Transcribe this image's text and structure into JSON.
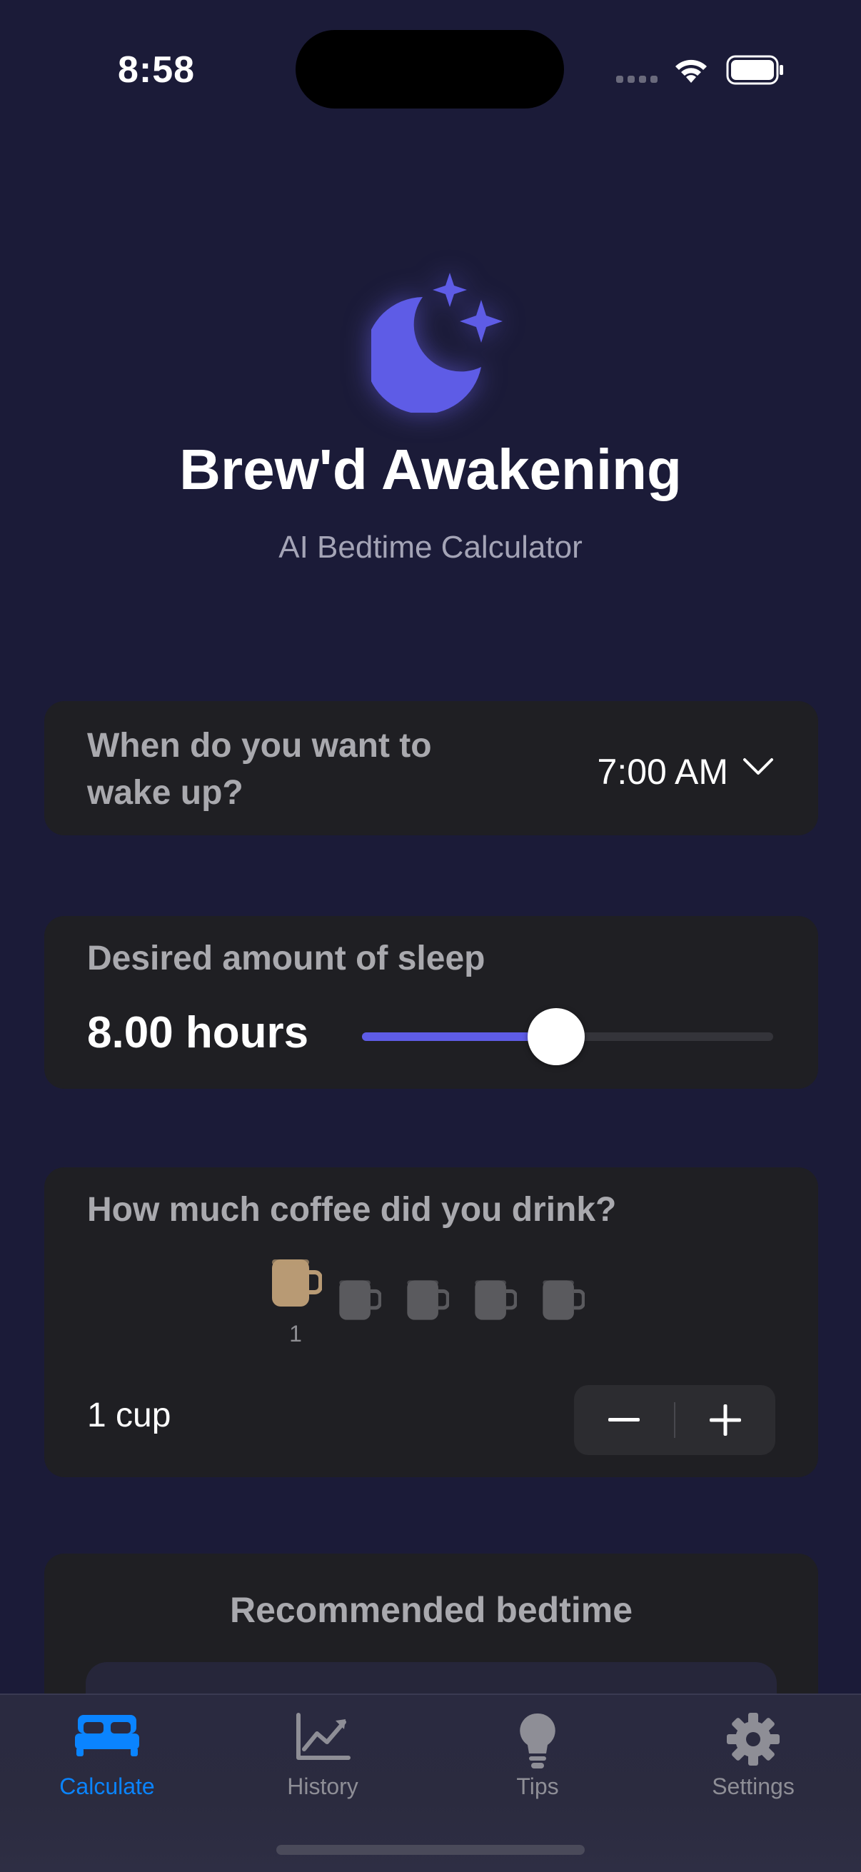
{
  "status_bar": {
    "time": "8:58",
    "icons": [
      "cellular-signal-icon",
      "wifi-icon",
      "battery-icon"
    ]
  },
  "header": {
    "logo_icon": "moon-stars-icon",
    "title": "Brew'd Awakening",
    "subtitle": "AI Bedtime Calculator"
  },
  "wake_card": {
    "label": "When do you want to wake up?",
    "value": "7:00 AM",
    "icon": "chevron-down-icon"
  },
  "sleep_card": {
    "label": "Desired amount of sleep",
    "value": "8.00 hours",
    "slider_fraction": 0.5
  },
  "coffee_card": {
    "label": "How much coffee did you drink?",
    "cups_total": 5,
    "cups_selected": 1,
    "selected_caption": "1",
    "count_text": "1 cup",
    "decrement_icon": "minus-icon",
    "increment_icon": "plus-icon",
    "colors": {
      "selected_mug": "#b89a74",
      "unselected_mug": "#5a5a5e"
    }
  },
  "bedtime_card": {
    "title": "Recommended bedtime"
  },
  "tab_bar": {
    "tabs": [
      {
        "label": "Calculate",
        "icon": "bed-icon",
        "active": true
      },
      {
        "label": "History",
        "icon": "chart-line-icon",
        "active": false
      },
      {
        "label": "Tips",
        "icon": "lightbulb-icon",
        "active": false
      },
      {
        "label": "Settings",
        "icon": "gear-icon",
        "active": false
      }
    ]
  },
  "colors": {
    "background": "#1b1b38",
    "card": "#1f1f23",
    "accent": "#5e5ce6",
    "tab_active": "#0a84ff",
    "tab_inactive": "#8e8e96"
  }
}
